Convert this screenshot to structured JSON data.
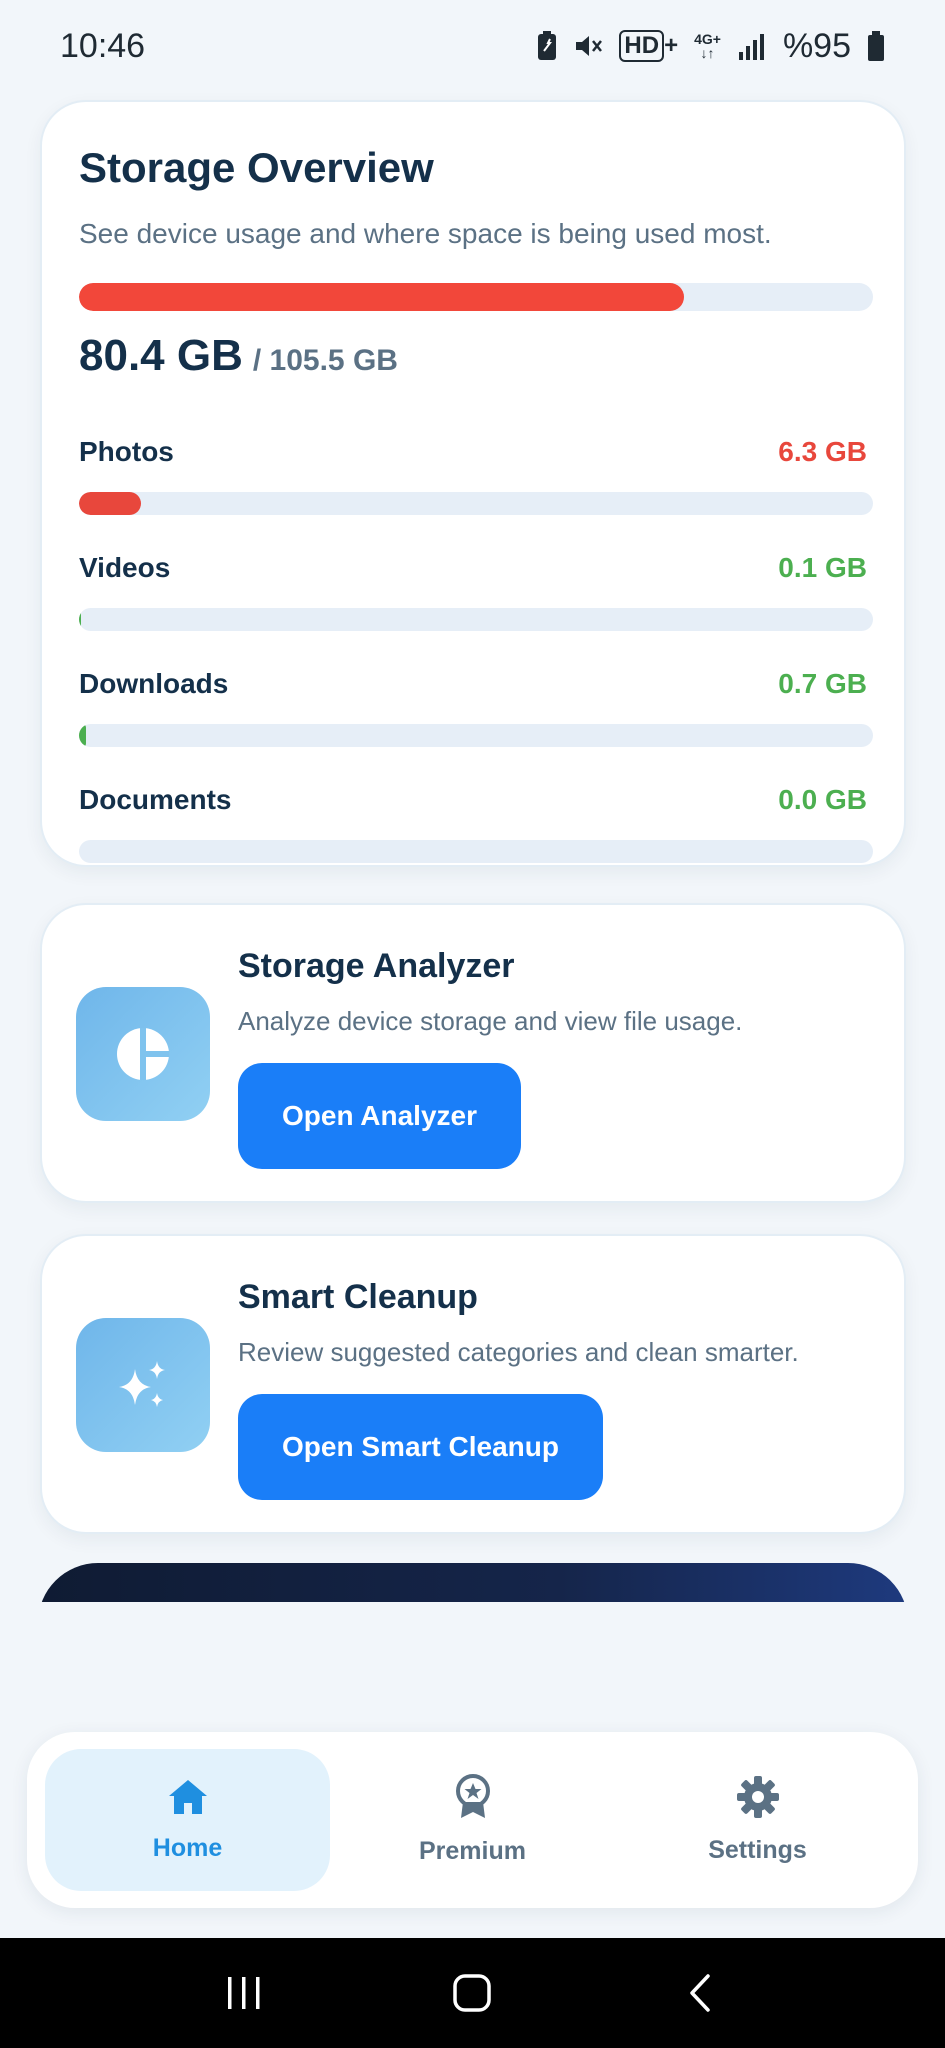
{
  "status_bar": {
    "time": "10:46",
    "network_hd": "HD+",
    "network_gen": "4G+",
    "battery": "%95"
  },
  "overview": {
    "title": "Storage Overview",
    "subtitle": "See device usage and where space is being used most.",
    "used": "80.4 GB",
    "total": "/ 105.5 GB",
    "used_fraction": 0.762,
    "bar_color": "#f2473a",
    "categories": [
      {
        "name": "Photos",
        "value": "6.3 GB",
        "fraction": 0.078,
        "color": "#e8473c"
      },
      {
        "name": "Videos",
        "value": "0.1 GB",
        "fraction": 0.002,
        "color": "#4caf50"
      },
      {
        "name": "Downloads",
        "value": "0.7 GB",
        "fraction": 0.009,
        "color": "#4caf50"
      },
      {
        "name": "Documents",
        "value": "0.0 GB",
        "fraction": 0.0,
        "color": "#4caf50"
      }
    ]
  },
  "analyzer": {
    "title": "Storage Analyzer",
    "subtitle": "Analyze device storage and view file usage.",
    "button": "Open Analyzer",
    "icon": "pie-chart-icon"
  },
  "cleanup": {
    "title": "Smart Cleanup",
    "subtitle": "Review suggested categories and clean smarter.",
    "button": "Open Smart Cleanup",
    "icon": "sparkle-icon"
  },
  "nav": {
    "items": [
      {
        "label": "Home",
        "icon": "home-icon",
        "active": true
      },
      {
        "label": "Premium",
        "icon": "award-icon",
        "active": false
      },
      {
        "label": "Settings",
        "icon": "gear-icon",
        "active": false
      }
    ]
  },
  "colors": {
    "accent": "#1a7ef8",
    "active_nav": "#1f8fe0"
  }
}
